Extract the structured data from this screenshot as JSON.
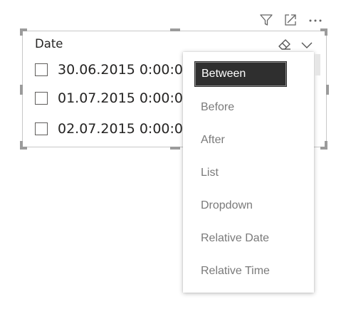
{
  "header_icons": [
    {
      "icon": "filter-icon"
    },
    {
      "icon": "focus-mode-icon"
    },
    {
      "icon": "more-options-icon"
    }
  ],
  "slicer": {
    "title": "Date",
    "clear_icon": "eraser-icon",
    "dropdown_icon": "chevron-down-icon",
    "items": [
      {
        "label": "30.06.2015 0:00:0",
        "checked": false
      },
      {
        "label": "01.07.2015 0:00:0",
        "checked": false
      },
      {
        "label": "02.07.2015 0:00:0",
        "checked": false
      }
    ]
  },
  "menu": {
    "selected": "Between",
    "options": [
      "Between",
      "Before",
      "After",
      "List",
      "Dropdown",
      "Relative Date",
      "Relative Time"
    ]
  },
  "colors": {
    "selected_bg": "#2f2f2f",
    "option_text": "#7a7a7a",
    "border": "#c8c8c8",
    "handle": "#9b9b9b"
  }
}
